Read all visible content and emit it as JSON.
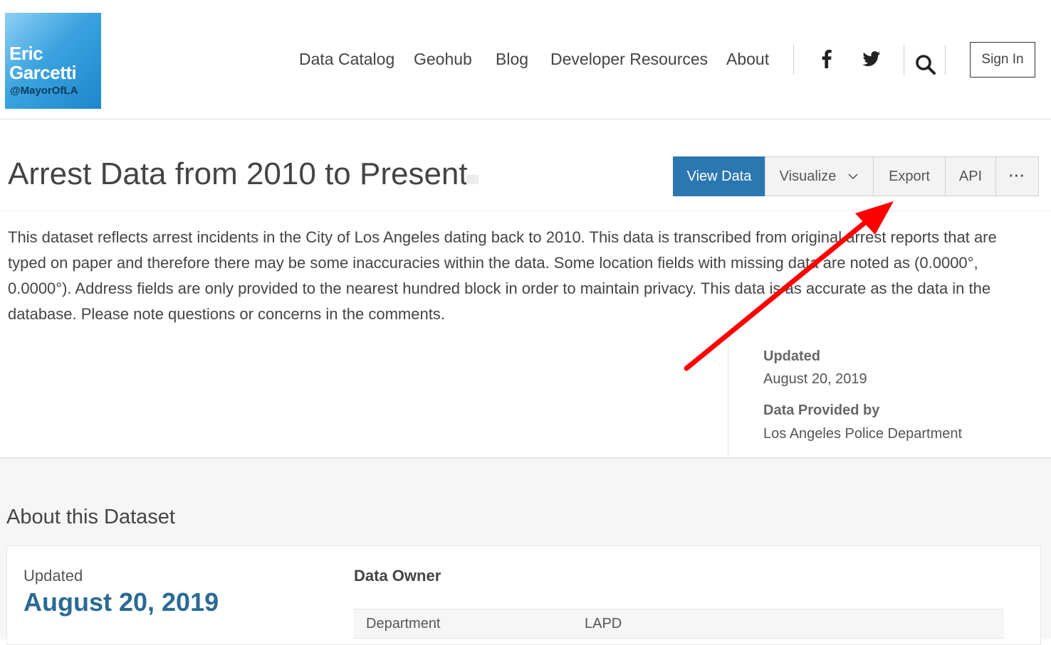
{
  "brand": {
    "line1": "Eric",
    "line2": "Garcetti",
    "handle": "@MayorOfLA"
  },
  "nav": {
    "links": [
      "Data Catalog",
      "Geohub",
      "Blog",
      "Developer Resources",
      "About"
    ],
    "sign_in": "Sign In",
    "icons": [
      "facebook-icon",
      "twitter-icon",
      "search-icon"
    ]
  },
  "dataset": {
    "title": "Arrest Data from 2010 to Present",
    "actions": {
      "view_data": "View Data",
      "visualize": "Visualize",
      "export": "Export",
      "api": "API",
      "more": "···"
    },
    "description": "This dataset reflects arrest incidents in the City of Los Angeles dating back to 2010. This data is transcribed from original arrest reports that are typed on paper and therefore there may be some inaccuracies within the data. Some location fields with missing data are noted as (0.0000°, 0.0000°). Address fields are only provided to the nearest hundred block in order to maintain privacy. This data is as accurate as the data in the database. Please note questions or concerns in the comments.",
    "meta": {
      "updated_label": "Updated",
      "updated_value": "August 20, 2019",
      "provider_label": "Data Provided by",
      "provider_value": "Los Angeles Police Department"
    }
  },
  "about": {
    "title": "About this Dataset",
    "updated_label": "Updated",
    "updated_value": "August 20, 2019",
    "owner_label": "Data Owner",
    "owner_rows": [
      {
        "key": "Department",
        "value": "LAPD"
      }
    ]
  },
  "colors": {
    "primary_button": "#2a77b2",
    "annotation_arrow": "#ff0000",
    "accent_text": "#2a6a95"
  }
}
